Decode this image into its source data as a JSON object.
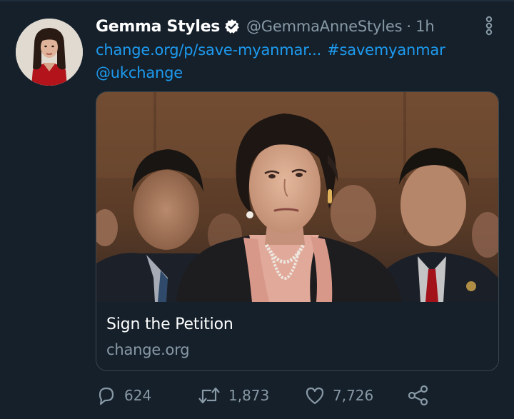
{
  "tweet": {
    "display_name": "Gemma Styles",
    "handle": "@GemmaAnneStyles",
    "separator": "·",
    "time": "1h",
    "link_text": "change.org/p/save-myanmar...",
    "hashtag": "#savemyanmar",
    "mention": "@ukchange"
  },
  "card": {
    "title": "Sign the Petition",
    "domain": "change.org"
  },
  "actions": {
    "replies": "624",
    "retweets": "1,873",
    "likes": "7,726"
  },
  "icons": {
    "verified": "verified-badge-icon",
    "more": "more-vertical-icon",
    "reply": "reply-icon",
    "retweet": "retweet-icon",
    "like": "heart-icon",
    "share": "share-icon"
  },
  "colors": {
    "background": "#15202b",
    "link": "#1d9bf0",
    "muted": "#8899a6",
    "border": "#38444d"
  }
}
